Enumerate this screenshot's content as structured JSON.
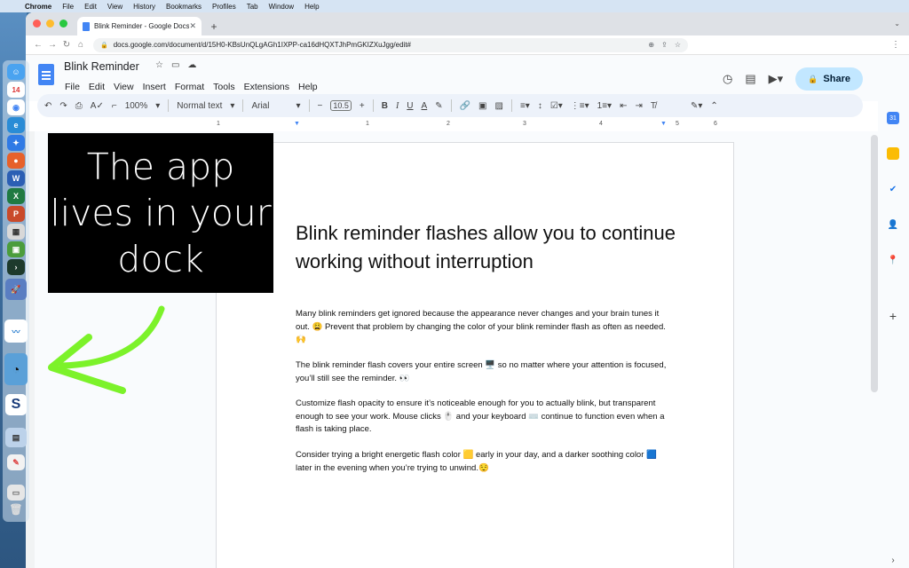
{
  "menubar": {
    "app": "Chrome",
    "items": [
      "File",
      "Edit",
      "View",
      "History",
      "Bookmarks",
      "Profiles",
      "Tab",
      "Window",
      "Help"
    ]
  },
  "browser": {
    "tab_title": "Blink Reminder - Google Docs",
    "url": "docs.google.com/document/d/15H0-KBsUnQLgAGh1IXPP-ca16dHQXTJhPmGKIZXuJgg/edit#"
  },
  "dock": {
    "calendar_day": "14"
  },
  "docs": {
    "title": "Blink Reminder",
    "menu": [
      "File",
      "Edit",
      "View",
      "Insert",
      "Format",
      "Tools",
      "Extensions",
      "Help"
    ],
    "share_label": "Share",
    "toolbar": {
      "zoom": "100%",
      "style": "Normal text",
      "font": "Arial",
      "font_size": "10.5",
      "bold": "B",
      "italic": "I",
      "underline": "U",
      "text_color": "A"
    },
    "ruler": [
      "1",
      "1",
      "2",
      "3",
      "4",
      "5",
      "6",
      "7"
    ]
  },
  "document": {
    "heading": "Blink reminder flashes allow you to continue working without interruption",
    "paragraphs": [
      "Many blink reminders get ignored because the appearance never changes and your brain tunes it out. 😩 Prevent that problem by changing the color of your blink reminder flash as often as needed. 🙌",
      "The blink reminder flash covers your entire screen 🖥️ so no matter where your attention is focused, you’ll still see the reminder. 👀",
      "Customize flash opacity to ensure it’s noticeable enough for you to actually blink, but transparent enough to see your work. Mouse clicks 🖱️ and your keyboard ⌨️ continue to function even when a flash is taking place.",
      "Consider trying a bright energetic flash color 🟨 early in your day, and a darker soothing color 🟦 later in the evening when you’re trying to unwind.😌"
    ]
  },
  "overlay": {
    "text": "The app lives in your dock"
  },
  "colors": {
    "docs_blue": "#4285f4",
    "share_bg": "#c2e7ff",
    "toolbar_bg": "#edf2fa",
    "arrow_green": "#7cf22a"
  }
}
